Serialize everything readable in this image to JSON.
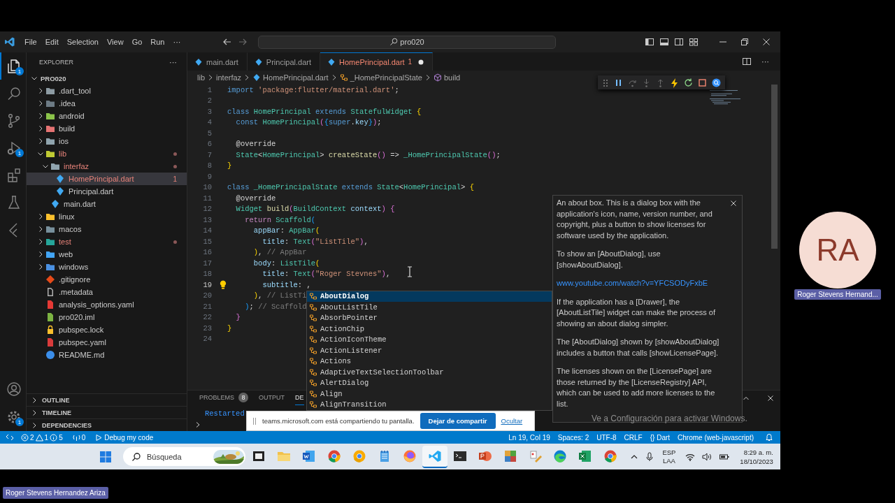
{
  "window": {
    "menu": [
      "File",
      "Edit",
      "Selection",
      "View",
      "Go",
      "Run",
      "···"
    ],
    "search": "pro020"
  },
  "activity_bar": {
    "items": [
      {
        "kind": "explorer",
        "selected": true,
        "badge": "1"
      },
      {
        "kind": "search",
        "selected": false
      },
      {
        "kind": "source-control",
        "selected": false
      },
      {
        "kind": "run-debug",
        "selected": false,
        "badge": "1"
      },
      {
        "kind": "extensions",
        "selected": false
      },
      {
        "kind": "testing",
        "selected": false
      },
      {
        "kind": "flutter",
        "selected": false
      }
    ],
    "bottom": [
      {
        "kind": "account"
      },
      {
        "kind": "settings",
        "badge": "1"
      }
    ]
  },
  "sidebar": {
    "title": "EXPLORER",
    "more": "···",
    "project": "PRO020",
    "tree": [
      {
        "label": ".dart_tool",
        "kind": "folder",
        "color": "#8d9ba3",
        "expanded": false,
        "problem": false,
        "selected": false
      },
      {
        "label": ".idea",
        "kind": "folder",
        "color": "#6d7b85",
        "expanded": false,
        "problem": false,
        "selected": false
      },
      {
        "label": "android",
        "kind": "folder",
        "color": "#8bc34a",
        "expanded": false,
        "problem": false,
        "selected": false
      },
      {
        "label": "build",
        "kind": "folder",
        "color": "#e57373",
        "expanded": false,
        "problem": false,
        "selected": false
      },
      {
        "label": "ios",
        "kind": "folder",
        "color": "#90a4ae",
        "expanded": false,
        "problem": false,
        "selected": false
      },
      {
        "label": "lib",
        "kind": "folder",
        "color": "#c0ca33",
        "expanded": true,
        "problem": true,
        "selected": false,
        "children": [
          {
            "label": "interfaz",
            "kind": "folder",
            "color": "#90a4ae",
            "expanded": true,
            "problem": true,
            "selected": false,
            "children": [
              {
                "label": "HomePrincipal.dart",
                "kind": "dart",
                "color": "#40a9f2",
                "problem": true,
                "selected": true,
                "badge": "1"
              },
              {
                "label": "Principal.dart",
                "kind": "dart",
                "color": "#40a9f2",
                "problem": false,
                "selected": false
              }
            ]
          },
          {
            "label": "main.dart",
            "kind": "dart",
            "color": "#40a9f2",
            "problem": false,
            "selected": false
          }
        ]
      },
      {
        "label": "linux",
        "kind": "folder",
        "color": "#fbc02d",
        "expanded": false,
        "problem": false,
        "selected": false
      },
      {
        "label": "macos",
        "kind": "folder",
        "color": "#78909c",
        "expanded": false,
        "problem": false,
        "selected": false
      },
      {
        "label": "test",
        "kind": "folder",
        "color": "#26a69a",
        "expanded": false,
        "problem": true,
        "selected": false
      },
      {
        "label": "web",
        "kind": "folder",
        "color": "#42a5f5",
        "expanded": false,
        "problem": false,
        "selected": false
      },
      {
        "label": "windows",
        "kind": "folder",
        "color": "#4a90e2",
        "expanded": false,
        "problem": false,
        "selected": false
      },
      {
        "label": ".gitignore",
        "kind": "git",
        "color": "#e64a19",
        "problem": false,
        "selected": false
      },
      {
        "label": ".metadata",
        "kind": "file",
        "color": "#b0b0b0",
        "problem": false,
        "selected": false
      },
      {
        "label": "analysis_options.yaml",
        "kind": "yaml",
        "color": "#e53935",
        "problem": false,
        "selected": false
      },
      {
        "label": "pro020.iml",
        "kind": "iml",
        "color": "#7cb342",
        "problem": false,
        "selected": false
      },
      {
        "label": "pubspec.lock",
        "kind": "lock",
        "color": "#fbc02d",
        "problem": false,
        "selected": false
      },
      {
        "label": "pubspec.yaml",
        "kind": "yaml",
        "color": "#d93b3b",
        "problem": false,
        "selected": false
      },
      {
        "label": "README.md",
        "kind": "info",
        "color": "#3b8eea",
        "problem": false,
        "selected": false
      }
    ],
    "sections": [
      "OUTLINE",
      "TIMELINE",
      "DEPENDENCIES"
    ]
  },
  "editor": {
    "tabs": [
      {
        "label": "main.dart",
        "selected": false,
        "problem": false,
        "dirty": false
      },
      {
        "label": "Principal.dart",
        "selected": false,
        "problem": false,
        "dirty": false
      },
      {
        "label": "HomePrincipal.dart",
        "selected": true,
        "problem": true,
        "badge": "1",
        "dirty": true
      }
    ],
    "breadcrumbs": [
      {
        "kind": "folder",
        "label": "lib"
      },
      {
        "kind": "folder",
        "label": "interfaz"
      },
      {
        "kind": "dart",
        "label": "HomePrincipal.dart"
      },
      {
        "kind": "class",
        "label": "_HomePrincipalState"
      },
      {
        "kind": "method",
        "label": "build"
      }
    ],
    "lines": [
      {
        "n": "1",
        "current": false,
        "bulb": false,
        "code": [
          {
            "kind": "keyword",
            "text": "import"
          },
          {
            "kind": "string",
            "text": " 'package:flutter/material.dart'"
          },
          {
            "kind": "plain",
            "text": ";"
          }
        ]
      },
      {
        "n": "2",
        "current": false,
        "bulb": false
      },
      {
        "n": "3",
        "current": false,
        "bulb": false,
        "code": [
          {
            "kind": "keyword",
            "text": "class"
          },
          {
            "kind": "type",
            "text": " HomePrincipal"
          },
          {
            "kind": "keyword",
            "text": " extends"
          },
          {
            "kind": "type",
            "text": " StatefulWidget"
          },
          {
            "kind": "paren1",
            "text": " {"
          }
        ]
      },
      {
        "n": "4",
        "current": false,
        "bulb": false,
        "code": [
          {
            "kind": "keyword",
            "text": "  const"
          },
          {
            "kind": "type",
            "text": " HomePrincipal"
          },
          {
            "kind": "paren2",
            "text": "("
          },
          {
            "kind": "paren3",
            "text": "{"
          },
          {
            "kind": "keyword",
            "text": "super"
          },
          {
            "kind": "plain",
            "text": "."
          },
          {
            "kind": "property",
            "text": "key"
          },
          {
            "kind": "paren3",
            "text": "}"
          },
          {
            "kind": "paren2",
            "text": ")"
          },
          {
            "kind": "plain",
            "text": ";"
          }
        ]
      },
      {
        "n": "5",
        "current": false,
        "bulb": false
      },
      {
        "n": "6",
        "current": false,
        "bulb": false,
        "code": [
          {
            "kind": "annotation",
            "text": "  @override"
          }
        ]
      },
      {
        "n": "7",
        "current": false,
        "bulb": false,
        "code": [
          {
            "kind": "type",
            "text": "  State"
          },
          {
            "kind": "plain",
            "text": "<"
          },
          {
            "kind": "type",
            "text": "HomePrincipal"
          },
          {
            "kind": "plain",
            "text": "> "
          },
          {
            "kind": "function",
            "text": "createState"
          },
          {
            "kind": "paren2",
            "text": "()"
          },
          {
            "kind": "plain",
            "text": " => "
          },
          {
            "kind": "type",
            "text": "_HomePrincipalState"
          },
          {
            "kind": "paren2",
            "text": "()"
          },
          {
            "kind": "plain",
            "text": ";"
          }
        ]
      },
      {
        "n": "8",
        "current": false,
        "bulb": false,
        "code": [
          {
            "kind": "paren1",
            "text": "}"
          }
        ]
      },
      {
        "n": "9",
        "current": false,
        "bulb": false
      },
      {
        "n": "10",
        "current": false,
        "bulb": false,
        "code": [
          {
            "kind": "keyword",
            "text": "class"
          },
          {
            "kind": "type",
            "text": " _HomePrincipalState"
          },
          {
            "kind": "keyword",
            "text": " extends"
          },
          {
            "kind": "type",
            "text": " State"
          },
          {
            "kind": "plain",
            "text": "<"
          },
          {
            "kind": "type",
            "text": "HomePrincipal"
          },
          {
            "kind": "plain",
            "text": "> "
          },
          {
            "kind": "paren1",
            "text": "{"
          }
        ]
      },
      {
        "n": "11",
        "current": false,
        "bulb": false,
        "code": [
          {
            "kind": "annotation",
            "text": "  @override"
          }
        ]
      },
      {
        "n": "12",
        "current": false,
        "bulb": false,
        "code": [
          {
            "kind": "type",
            "text": "  Widget"
          },
          {
            "kind": "function",
            "text": " build"
          },
          {
            "kind": "paren2",
            "text": "("
          },
          {
            "kind": "type",
            "text": "BuildContext"
          },
          {
            "kind": "property",
            "text": " context"
          },
          {
            "kind": "paren2",
            "text": ")"
          },
          {
            "kind": "paren2",
            "text": " {"
          }
        ]
      },
      {
        "n": "13",
        "current": false,
        "bulb": false,
        "code": [
          {
            "kind": "control",
            "text": "    return"
          },
          {
            "kind": "type",
            "text": " Scaffold"
          },
          {
            "kind": "paren3",
            "text": "("
          }
        ]
      },
      {
        "n": "14",
        "current": false,
        "bulb": false,
        "code": [
          {
            "kind": "property",
            "text": "      appBar"
          },
          {
            "kind": "plain",
            "text": ": "
          },
          {
            "kind": "type",
            "text": "AppBar"
          },
          {
            "kind": "paren1",
            "text": "("
          }
        ]
      },
      {
        "n": "15",
        "current": false,
        "bulb": false,
        "code": [
          {
            "kind": "property",
            "text": "        title"
          },
          {
            "kind": "plain",
            "text": ": "
          },
          {
            "kind": "type",
            "text": "Text"
          },
          {
            "kind": "paren2",
            "text": "("
          },
          {
            "kind": "string",
            "text": "\"ListTile\""
          },
          {
            "kind": "paren2",
            "text": ")"
          },
          {
            "kind": "plain",
            "text": ","
          }
        ]
      },
      {
        "n": "16",
        "current": false,
        "bulb": false,
        "code": [
          {
            "kind": "paren1",
            "text": "      )"
          },
          {
            "kind": "plain",
            "text": ", "
          },
          {
            "kind": "comment",
            "text": "// AppBar"
          }
        ]
      },
      {
        "n": "17",
        "current": false,
        "bulb": false,
        "code": [
          {
            "kind": "property",
            "text": "      body"
          },
          {
            "kind": "plain",
            "text": ": "
          },
          {
            "kind": "type",
            "text": "ListTile"
          },
          {
            "kind": "paren1",
            "text": "("
          }
        ]
      },
      {
        "n": "18",
        "current": false,
        "bulb": false,
        "code": [
          {
            "kind": "property",
            "text": "        title"
          },
          {
            "kind": "plain",
            "text": ": "
          },
          {
            "kind": "type",
            "text": "Text"
          },
          {
            "kind": "paren2",
            "text": "("
          },
          {
            "kind": "string",
            "text": "\"Roger Stevnes\""
          },
          {
            "kind": "paren2",
            "text": ")"
          },
          {
            "kind": "plain",
            "text": ","
          }
        ]
      },
      {
        "n": "19",
        "current": true,
        "bulb": true,
        "code": [
          {
            "kind": "property",
            "text": "        subtitle"
          },
          {
            "kind": "plain",
            "text": ": ,"
          }
        ]
      },
      {
        "n": "20",
        "current": false,
        "bulb": false,
        "code": [
          {
            "kind": "paren1",
            "text": "      )"
          },
          {
            "kind": "plain",
            "text": ", "
          },
          {
            "kind": "comment",
            "text": "// ListTi"
          }
        ]
      },
      {
        "n": "21",
        "current": false,
        "bulb": false,
        "code": [
          {
            "kind": "paren3",
            "text": "    )"
          },
          {
            "kind": "plain",
            "text": "; "
          },
          {
            "kind": "comment",
            "text": "// Scaffold"
          }
        ]
      },
      {
        "n": "22",
        "current": false,
        "bulb": false,
        "code": [
          {
            "kind": "paren2",
            "text": "  }"
          }
        ]
      },
      {
        "n": "23",
        "current": false,
        "bulb": false,
        "code": [
          {
            "kind": "paren1",
            "text": "}"
          }
        ]
      },
      {
        "n": "24",
        "current": false,
        "bulb": false
      }
    ],
    "suggestions": [
      {
        "label": "AboutDialog",
        "selected": true
      },
      {
        "label": "AboutListTile",
        "selected": false
      },
      {
        "label": "AbsorbPointer",
        "selected": false
      },
      {
        "label": "ActionChip",
        "selected": false
      },
      {
        "label": "ActionIconTheme",
        "selected": false
      },
      {
        "label": "ActionListener",
        "selected": false
      },
      {
        "label": "Actions",
        "selected": false
      },
      {
        "label": "AdaptiveTextSelectionToolbar",
        "selected": false
      },
      {
        "label": "AlertDialog",
        "selected": false
      },
      {
        "label": "Align",
        "selected": false
      },
      {
        "label": "AlignTransition",
        "selected": false
      }
    ],
    "doc": [
      {
        "kind": "text",
        "text": "An about box. This is a dialog box with the application's icon, name, version number, and copyright, plus a button to show licenses for software used by the application."
      },
      {
        "kind": "text",
        "text": "To show an [AboutDialog], use [showAboutDialog]."
      },
      {
        "kind": "link",
        "text": "www.youtube.com/watch?v=YFCSODyFxbE"
      },
      {
        "kind": "text",
        "text": "If the application has a [Drawer], the [AboutListTile] widget can make the process of showing an about dialog simpler."
      },
      {
        "kind": "text",
        "text": "The [AboutDialog] shown by [showAboutDialog] includes a button that calls [showLicensePage]."
      },
      {
        "kind": "text",
        "text": "The licenses shown on the [LicensePage] are those returned by the [LicenseRegistry] API, which can be used to add more licenses to the list."
      }
    ]
  },
  "panel": {
    "tabs": [
      {
        "label": "PROBLEMS",
        "badge": "8",
        "selected": false
      },
      {
        "label": "OUTPUT",
        "selected": false
      },
      {
        "label": "DE",
        "selected": true
      }
    ],
    "output": "Restarted"
  },
  "status_bar": {
    "left": [
      {
        "kind": "remote"
      },
      {
        "kind": "problems",
        "errors": "2",
        "warnings": "1",
        "infos": "5"
      },
      {
        "kind": "ports",
        "text": "0"
      },
      {
        "kind": "debug",
        "text": "Debug my code"
      }
    ],
    "right": [
      "Ln 19, Col 19",
      "Spaces: 2",
      "UTF-8",
      "CRLF",
      "{} Dart",
      "Chrome (web-javascript)"
    ]
  },
  "screen_share": {
    "message": "teams.microsoft.com está compartiendo tu pantalla.",
    "stop": "Dejar de compartir",
    "hide": "Ocultar"
  },
  "os_notice": "Ve a Configuración para activar Windows.",
  "taskbar": {
    "search": "Búsqueda",
    "apps": [
      {
        "kind": "task-view",
        "selected": false
      },
      {
        "kind": "folder",
        "selected": false
      },
      {
        "kind": "document",
        "selected": false
      },
      {
        "kind": "browser-red",
        "selected": false
      },
      {
        "kind": "browser-yellow",
        "selected": false
      },
      {
        "kind": "notepad",
        "selected": false
      },
      {
        "kind": "browser-orange",
        "selected": false
      },
      {
        "kind": "editor",
        "selected": true
      },
      {
        "kind": "terminal",
        "selected": false
      },
      {
        "kind": "slides",
        "selected": false
      },
      {
        "kind": "cube",
        "selected": false
      },
      {
        "kind": "paint",
        "selected": false
      },
      {
        "kind": "browser-blue",
        "selected": false
      },
      {
        "kind": "sheet",
        "selected": false
      },
      {
        "kind": "browser-red",
        "selected": false
      }
    ],
    "language": [
      "ESP",
      "LAA"
    ],
    "time": "8:29 a. m.",
    "date": "18/10/2023"
  },
  "participant": {
    "initials": "RA",
    "name": "Roger Stevens Hernand..."
  },
  "presenter": {
    "name": "Roger Stevens Hernandez Ariza"
  }
}
